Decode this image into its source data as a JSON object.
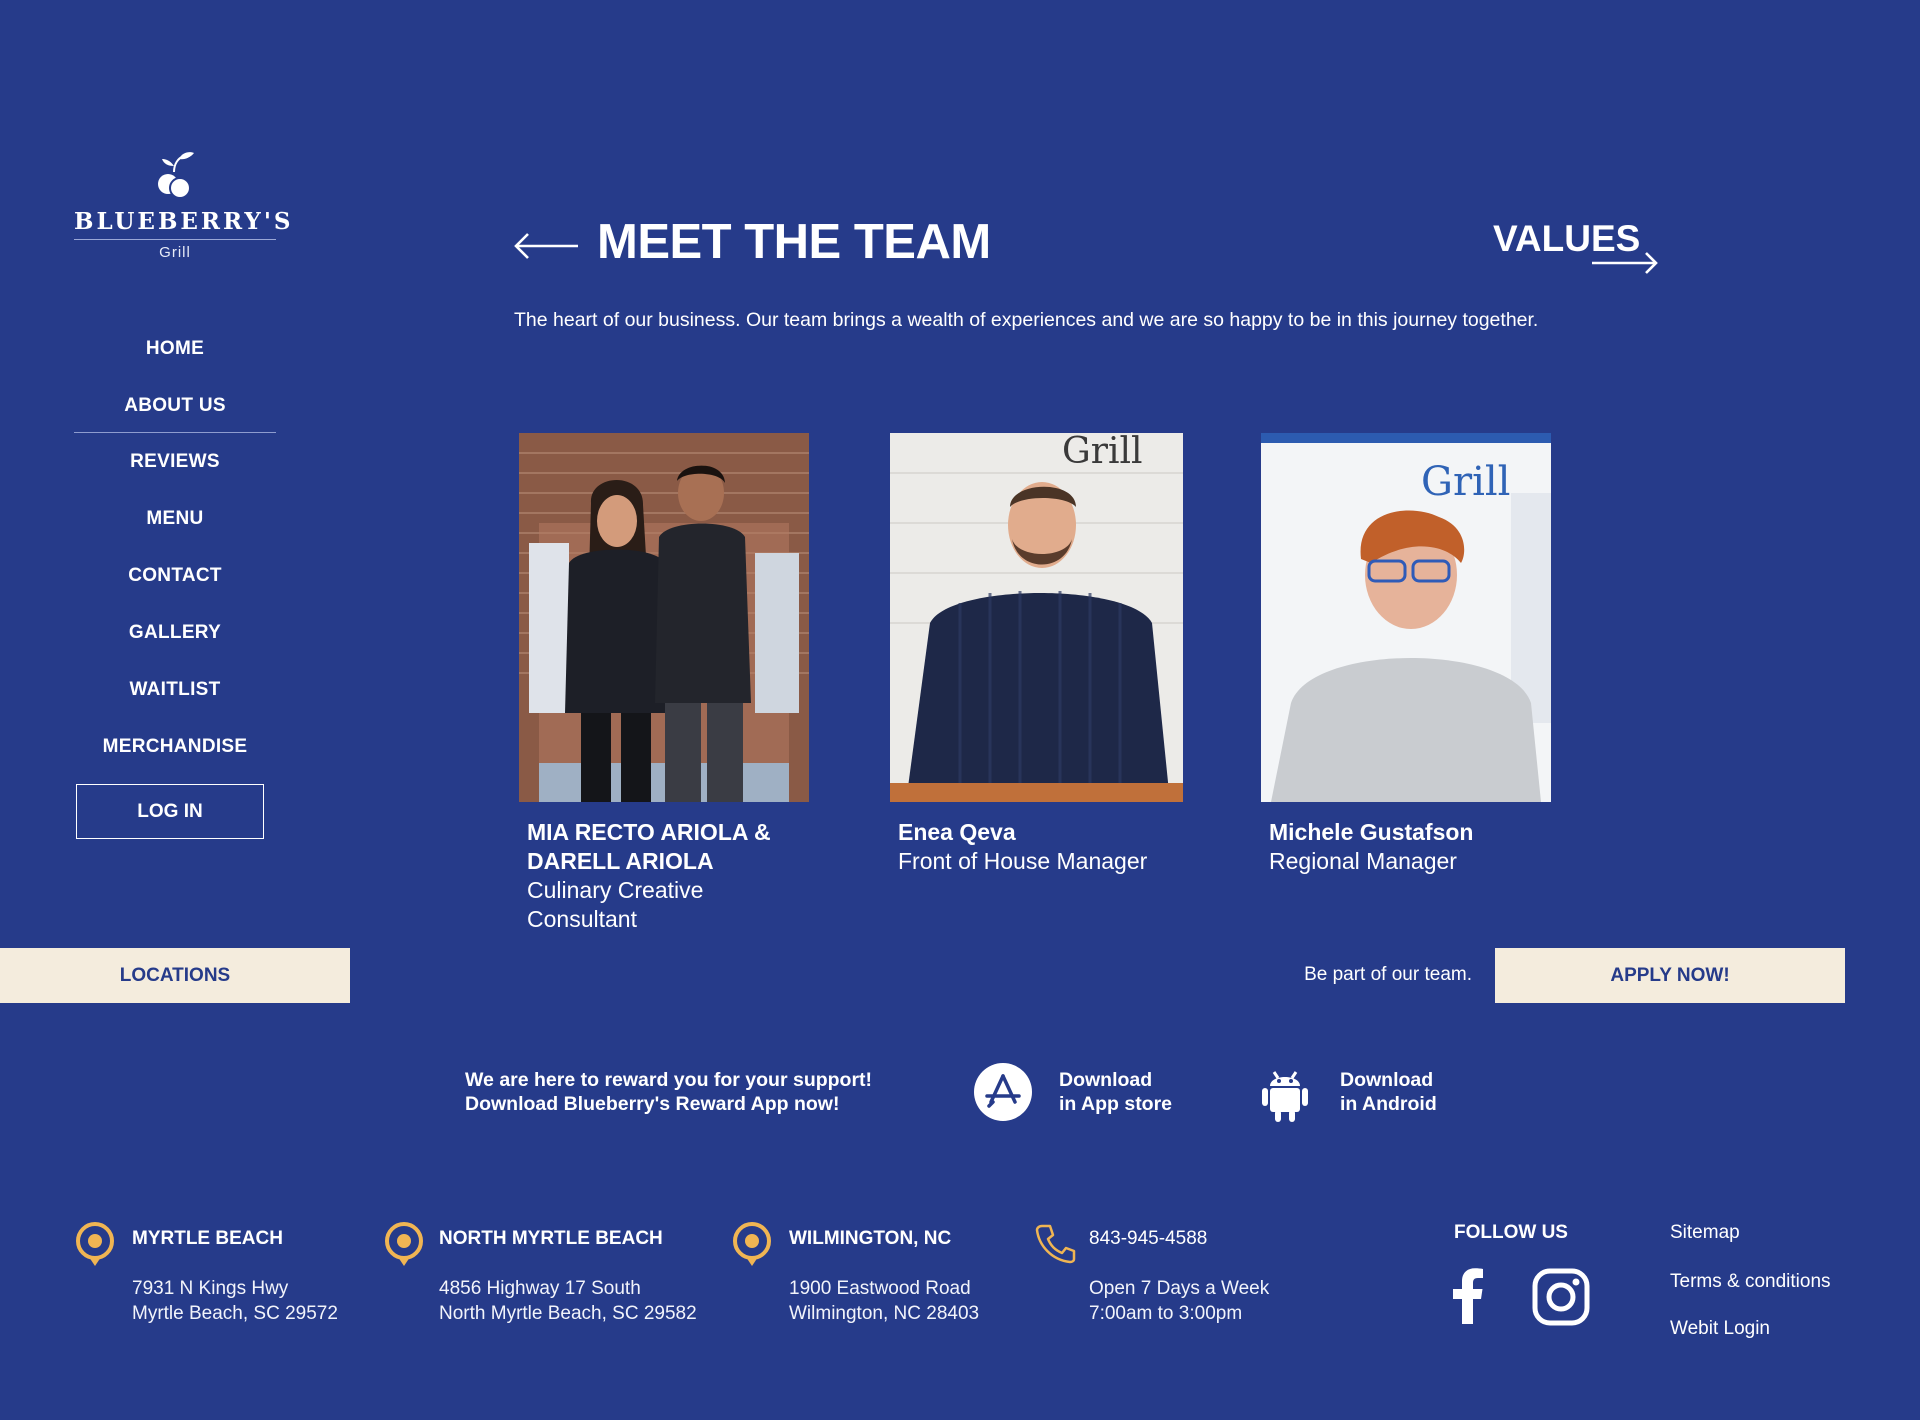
{
  "brand": {
    "name": "BLUEBERRY'S",
    "sub": "Grill",
    "icon": "blueberry-logo-icon"
  },
  "nav": {
    "items": [
      {
        "label": "HOME"
      },
      {
        "label": "ABOUT US"
      },
      {
        "label": "REVIEWS"
      },
      {
        "label": "MENU"
      },
      {
        "label": "CONTACT"
      },
      {
        "label": "GALLERY"
      },
      {
        "label": "WAITLIST"
      },
      {
        "label": "MERCHANDISE"
      }
    ],
    "active": "ABOUT US",
    "login": "LOG IN"
  },
  "locations_button": "LOCATIONS",
  "header": {
    "title": "MEET THE TEAM",
    "next": "VALUES",
    "intro": "The heart of our business. Our team brings a wealth of experiences and we are so happy to be in this journey together."
  },
  "team": [
    {
      "name": "MIA RECTO ARIOLA & DARELL ARIOLA",
      "role": "Culinary Creative Consultant"
    },
    {
      "name": "Enea Qeva",
      "role": "Front of House Manager"
    },
    {
      "name": "Michele Gustafson",
      "role": "Regional Manager"
    }
  ],
  "photo_text": {
    "sign": "Grill"
  },
  "cta": {
    "text": "Be part of our team.",
    "button": "APPLY NOW!"
  },
  "app": {
    "reward_line1": "We are here to reward you for your support!",
    "reward_line2": "Download Blueberry's Reward App now!",
    "appstore_line1": "Download",
    "appstore_line2": "in App store",
    "android_line1": "Download",
    "android_line2": "in Android"
  },
  "footer": {
    "locations": [
      {
        "name": "MYRTLE BEACH",
        "line1": "7931 N Kings Hwy",
        "line2": "Myrtle Beach, SC 29572"
      },
      {
        "name": "NORTH MYRTLE BEACH",
        "line1": "4856 Highway 17 South",
        "line2": "North Myrtle Beach, SC 29582"
      },
      {
        "name": "WILMINGTON, NC",
        "line1": "1900 Eastwood Road",
        "line2": "Wilmington, NC 28403"
      }
    ],
    "phone": "843-945-4588",
    "hours_line1": "Open 7 Days a Week",
    "hours_line2": "7:00am to 3:00pm",
    "follow": "FOLLOW US",
    "links": [
      "Sitemap",
      "Terms & conditions",
      "Webit Login"
    ]
  },
  "colors": {
    "background": "#263b8a",
    "cream": "#f4ecdd",
    "pin": "#f0b553",
    "text": "#ffffff"
  }
}
